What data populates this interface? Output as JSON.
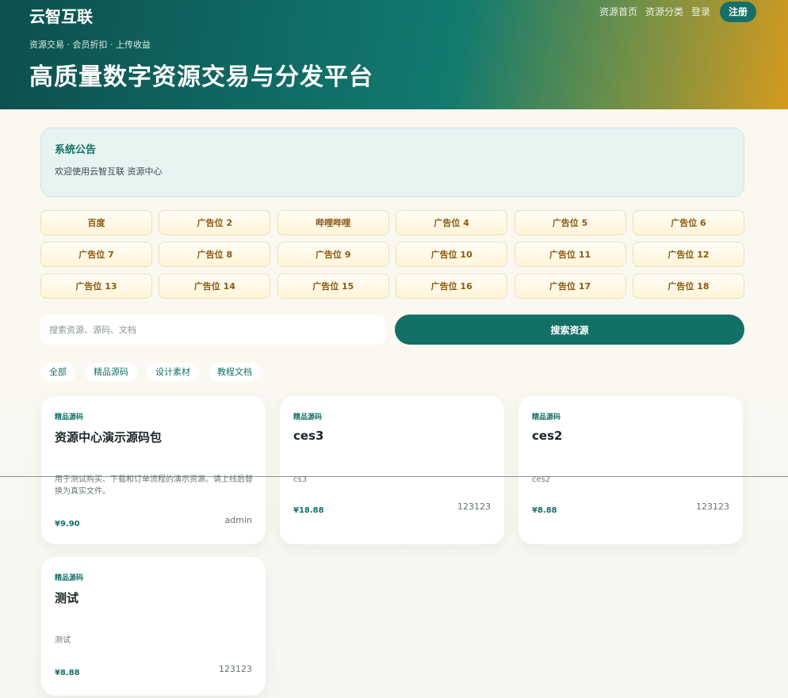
{
  "header": {
    "brand": "云智互联",
    "nav": [
      "资源首页",
      "资源分类",
      "登录"
    ],
    "register": "注册",
    "tagline": "资源交易 · 会员折扣 · 上传收益",
    "headline": "高质量数字资源交易与分发平台"
  },
  "notice": {
    "title": "系统公告",
    "text": "欢迎使用云智互联 资源中心"
  },
  "ads": [
    "百度",
    "广告位 2",
    "哔哩哔哩",
    "广告位 4",
    "广告位 5",
    "广告位 6",
    "广告位 7",
    "广告位 8",
    "广告位 9",
    "广告位 10",
    "广告位 11",
    "广告位 12",
    "广告位 13",
    "广告位 14",
    "广告位 15",
    "广告位 16",
    "广告位 17",
    "广告位 18"
  ],
  "search": {
    "placeholder": "搜索资源、源码、文档",
    "button": "搜索资源"
  },
  "tabs": [
    "全部",
    "精品源码",
    "设计素材",
    "教程文档"
  ],
  "cards": [
    {
      "category": "精品源码",
      "title": "资源中心演示源码包",
      "desc": "用于测试购买、下载和订单流程的演示资源。请上线后替换为真实文件。",
      "price": "¥9.90",
      "author": "admin"
    },
    {
      "category": "精品源码",
      "title": "ces3",
      "desc": "cs3",
      "price": "¥18.88",
      "author": "123123"
    },
    {
      "category": "精品源码",
      "title": "ces2",
      "desc": "ces2",
      "price": "¥8.88",
      "author": "123123"
    },
    {
      "category": "精品源码",
      "title": "测试",
      "desc": "测试",
      "price": "¥8.88",
      "author": "123123"
    }
  ],
  "colors": {
    "accent": "#137066",
    "ad_text": "#8a5a12"
  }
}
